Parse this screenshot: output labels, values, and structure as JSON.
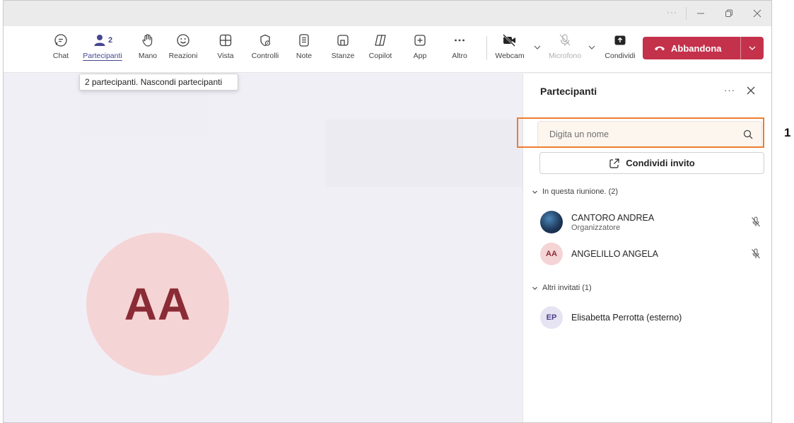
{
  "window": {
    "more_dots": "···"
  },
  "toolbar": {
    "chat": "Chat",
    "participants": "Partecipanti",
    "participants_count": "2",
    "hand": "Mano",
    "reactions": "Reazioni",
    "view": "Vista",
    "controls": "Controlli",
    "notes": "Note",
    "rooms": "Stanze",
    "copilot": "Copilot",
    "app": "App",
    "more": "Altro",
    "webcam": "Webcam",
    "microphone": "Microfono",
    "share": "Condividi",
    "leave": "Abbandona"
  },
  "tooltip": {
    "text": "2 partecipanti. Nascondi partecipanti"
  },
  "stage": {
    "avatar_initials": "AA"
  },
  "panel": {
    "title": "Partecipanti",
    "more": "···",
    "search_placeholder": "Digita un nome",
    "invite_label": "Condividi invito",
    "section_in_meeting": "In questa riunione. (2)",
    "section_others": "Altri invitati (1)",
    "participants": [
      {
        "name": "CANTORO ANDREA",
        "role": "Organizzatore",
        "initials": ""
      },
      {
        "name": "ANGELILLO ANGELA",
        "role": "",
        "initials": "AA"
      }
    ],
    "invited": [
      {
        "name": "Elisabetta Perrotta (esterno)",
        "initials": "EP"
      }
    ]
  },
  "callout": {
    "number": "1"
  },
  "colors": {
    "accent": "#444791",
    "leave": "#c4314b",
    "highlight": "#ed7d31",
    "avatar_aa_bg": "#f5d4d5",
    "avatar_aa_fg": "#8a2b35"
  }
}
